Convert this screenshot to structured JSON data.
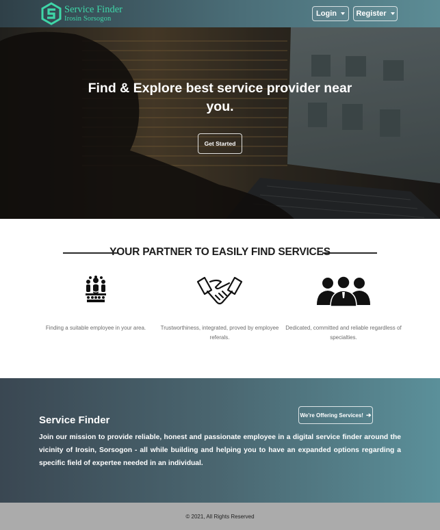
{
  "nav": {
    "logo_title": "Service Finder",
    "logo_subtitle": "Irosin Sorsogon",
    "login_label": "Login",
    "register_label": "Register",
    "accent_color": "#3fd6a8"
  },
  "hero": {
    "title": "Find & Explore best service provider near you.",
    "cta_label": "Get Started"
  },
  "partner": {
    "heading": "YOUR PARTNER TO EASILY FIND SERVICES",
    "features": [
      {
        "icon": "employee-group-icon",
        "text": "Finding a suitable employee in your area."
      },
      {
        "icon": "handshake-icon",
        "text": "Trustworthiness, integrated, proved by employee referals."
      },
      {
        "icon": "team-people-icon",
        "text": "Dedicated, committed and reliable regardless of specialties."
      }
    ]
  },
  "about": {
    "title": "Service Finder",
    "offer_label": "We're Offering Services!",
    "offer_icon": "arrow-right-icon",
    "text": "Join our mission to provide reliable, honest and passionate employee in a digital service finder around the vicinity of Irosin, Sorsogon - all while building and helping you to have an expanded options regarding a specific field of expertee needed in an individual."
  },
  "footer": {
    "copyright": "© 2021, All Rights Reserved"
  }
}
